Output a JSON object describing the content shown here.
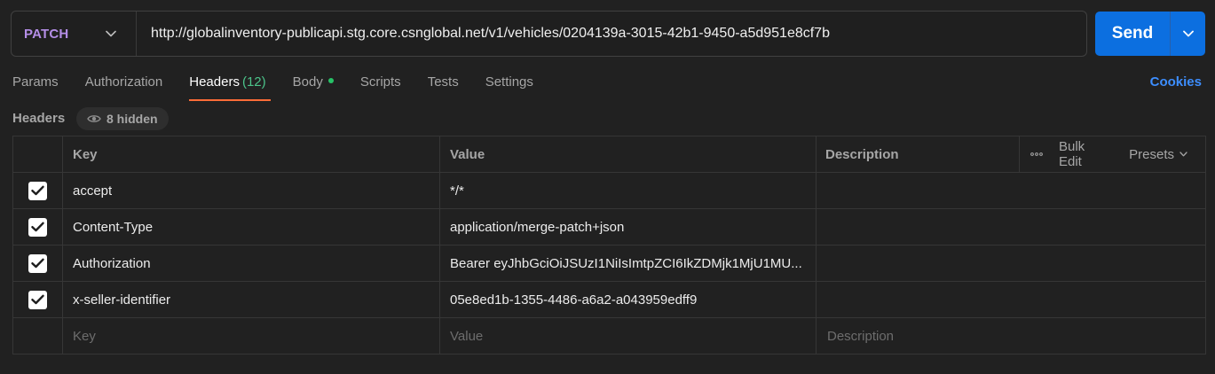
{
  "request": {
    "method": "PATCH",
    "url": "http://globalinventory-publicapi.stg.core.csnglobal.net/v1/vehicles/0204139a-3015-42b1-9450-a5d951e8cf7b",
    "send_label": "Send"
  },
  "colors": {
    "method": "#b48ee7",
    "send": "#0c6fe0",
    "active_tab_underline": "#ff6c37",
    "count": "#4cc38a",
    "cookies": "#3d8eff"
  },
  "tabs": [
    {
      "label": "Params"
    },
    {
      "label": "Authorization"
    },
    {
      "label": "Headers",
      "count": "(12)",
      "active": true
    },
    {
      "label": "Body",
      "dot": true
    },
    {
      "label": "Scripts"
    },
    {
      "label": "Tests"
    },
    {
      "label": "Settings"
    }
  ],
  "cookies_label": "Cookies",
  "headers_section": {
    "title": "Headers",
    "hidden_label": "8 hidden",
    "hidden_icon": "eye-icon"
  },
  "table": {
    "columns": {
      "key": "Key",
      "value": "Value",
      "description": "Description"
    },
    "tools": {
      "more_icon": "more-horizontal-icon",
      "bulk_edit": "Bulk Edit",
      "presets": "Presets"
    },
    "rows": [
      {
        "checked": true,
        "key": "accept",
        "value": "*/*",
        "description": ""
      },
      {
        "checked": true,
        "key": "Content-Type",
        "value": "application/merge-patch+json",
        "description": ""
      },
      {
        "checked": true,
        "key": "Authorization",
        "value": "Bearer eyJhbGciOiJSUzI1NiIsImtpZCI6IkZDMjk1MjU1MU...",
        "description": ""
      },
      {
        "checked": true,
        "key": "x-seller-identifier",
        "value": "05e8ed1b-1355-4486-a6a2-a043959edff9",
        "description": ""
      }
    ],
    "placeholders": {
      "key": "Key",
      "value": "Value",
      "description": "Description"
    }
  }
}
